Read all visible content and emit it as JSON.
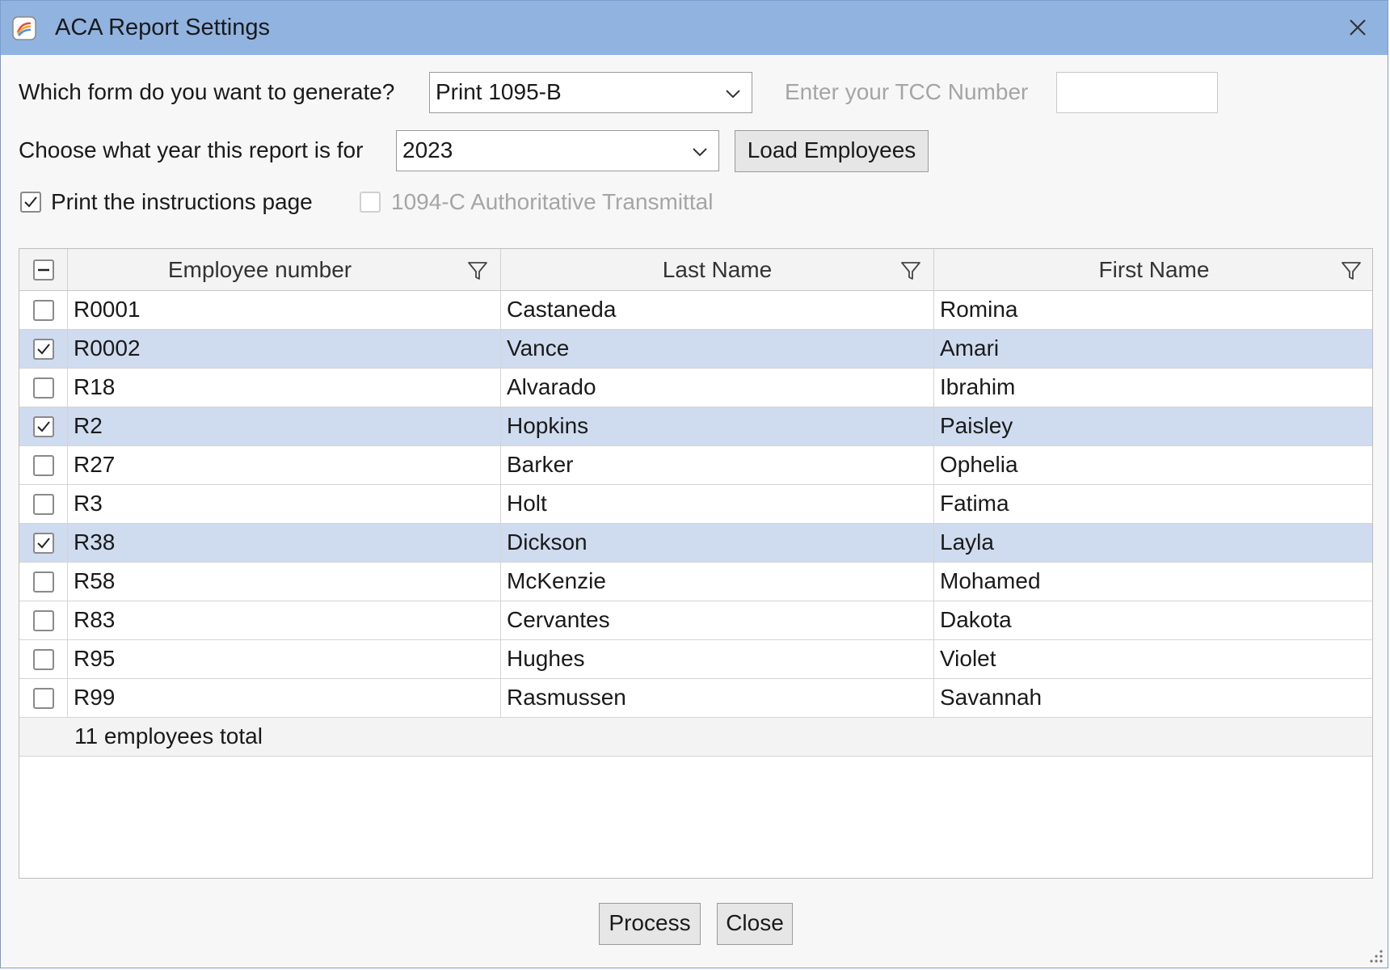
{
  "window": {
    "title": "ACA Report Settings",
    "icon": "app-logo-icon",
    "close_icon": "close-icon"
  },
  "form": {
    "form_label": "Which form do you want to generate?",
    "form_value": "Print 1095-B",
    "tcc_label": "Enter your TCC Number",
    "tcc_value": "",
    "year_label": "Choose what year this report is for",
    "year_value": "2023",
    "load_button": "Load Employees",
    "print_instructions_label": "Print the instructions page",
    "print_instructions_checked": true,
    "transmittal_label": "1094-C Authoritative Transmittal",
    "transmittal_checked": false,
    "transmittal_enabled": false
  },
  "grid": {
    "columns": [
      "Employee number",
      "Last Name",
      "First Name"
    ],
    "rows": [
      {
        "number": "R0001",
        "last": "Castaneda",
        "first": "Romina",
        "checked": false
      },
      {
        "number": "R0002",
        "last": "Vance",
        "first": "Amari",
        "checked": true
      },
      {
        "number": "R18",
        "last": "Alvarado",
        "first": "Ibrahim",
        "checked": false
      },
      {
        "number": "R2",
        "last": "Hopkins",
        "first": "Paisley",
        "checked": true
      },
      {
        "number": "R27",
        "last": "Barker",
        "first": "Ophelia",
        "checked": false
      },
      {
        "number": "R3",
        "last": "Holt",
        "first": "Fatima",
        "checked": false
      },
      {
        "number": "R38",
        "last": "Dickson",
        "first": "Layla",
        "checked": true
      },
      {
        "number": "R58",
        "last": "McKenzie",
        "first": "Mohamed",
        "checked": false
      },
      {
        "number": "R83",
        "last": "Cervantes",
        "first": "Dakota",
        "checked": false
      },
      {
        "number": "R95",
        "last": "Hughes",
        "first": "Violet",
        "checked": false
      },
      {
        "number": "R99",
        "last": "Rasmussen",
        "first": "Savannah",
        "checked": false
      }
    ],
    "summary": "11 employees total",
    "selection_color": "#cfdcef"
  },
  "footer": {
    "process_button": "Process",
    "close_button": "Close"
  }
}
